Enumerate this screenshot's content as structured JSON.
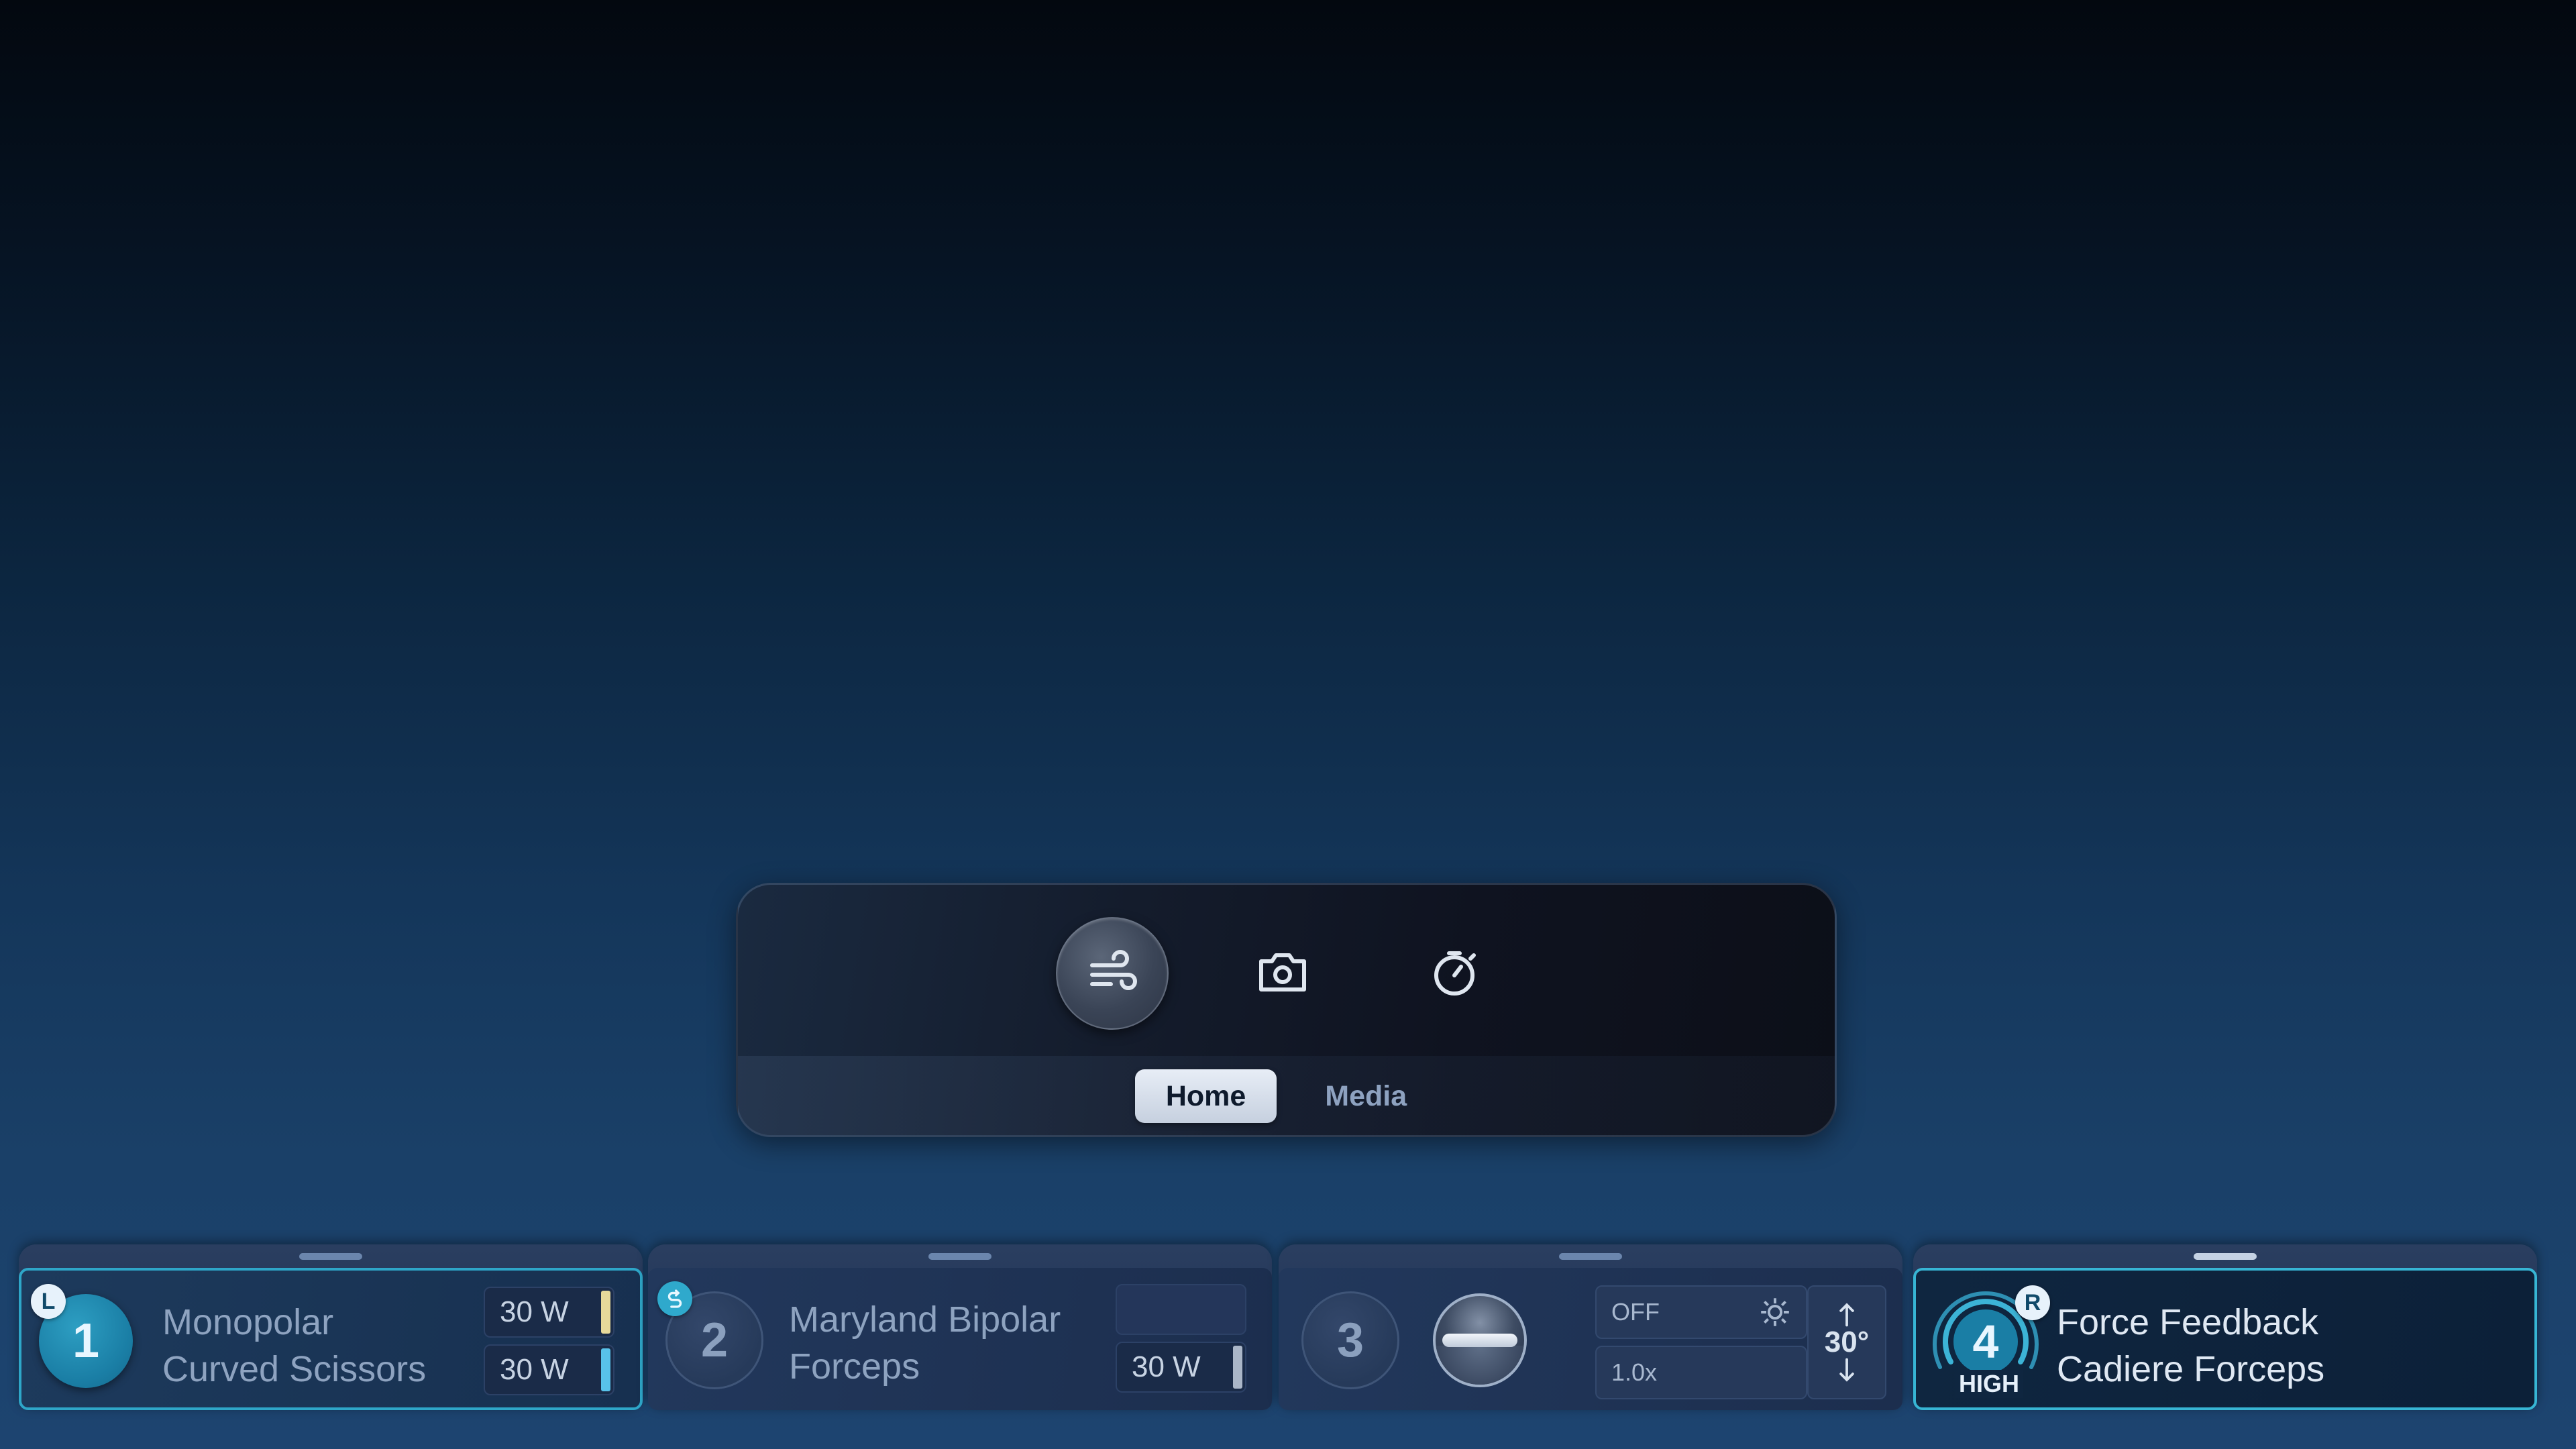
{
  "panel": {
    "buttons": [
      {
        "icon": "insufflation-icon",
        "active": true
      },
      {
        "icon": "camera-icon",
        "active": false
      },
      {
        "icon": "stopwatch-icon",
        "active": false
      }
    ],
    "tabs": [
      {
        "label": "Home",
        "active": true
      },
      {
        "label": "Media",
        "active": false
      }
    ]
  },
  "instruments": [
    {
      "arm": "1",
      "badge": "L",
      "name_line1": "Monopolar",
      "name_line2": "Curved Scissors",
      "power_top": "30 W",
      "power_bottom": "30 W",
      "top_bar_color": "#e6d99a",
      "bottom_bar_color": "#58c2ea"
    },
    {
      "arm": "2",
      "badge_icon": "swap-icon",
      "name_line1": "Maryland Bipolar",
      "name_line2": "Forceps",
      "power_top": "",
      "power_bottom": "30 W",
      "bottom_bar_color": "#aab6c8"
    },
    {
      "arm": "3",
      "mode": "OFF",
      "zoom": "1.0x",
      "angle": "30°"
    },
    {
      "arm": "4",
      "badge": "R",
      "level": "HIGH",
      "name_line1": "Force Feedback",
      "name_line2": "Cadiere Forceps"
    }
  ],
  "colors": {
    "accent": "#2ea6c8",
    "active_arm": "#1a7ea5"
  }
}
